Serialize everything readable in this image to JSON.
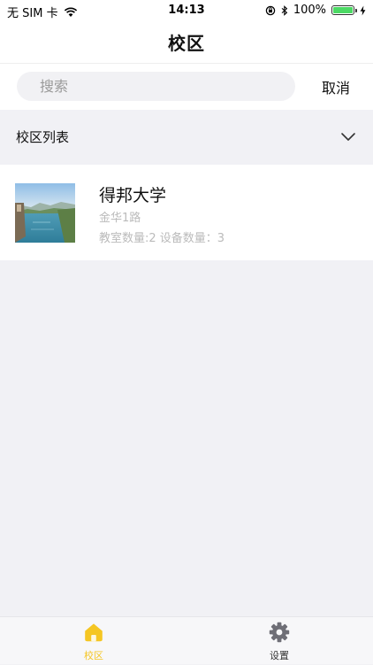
{
  "status_bar": {
    "carrier": "无 SIM 卡",
    "time": "14:13",
    "battery": "100%",
    "icons": [
      "wifi-icon",
      "orientation-lock-icon",
      "bluetooth-icon",
      "battery-icon",
      "charging-icon"
    ]
  },
  "header": {
    "title": "校区"
  },
  "search": {
    "placeholder": "搜索",
    "value": "",
    "cancel_label": "取消"
  },
  "section": {
    "title": "校区列表",
    "icon": "chevron-down-icon"
  },
  "campuses": [
    {
      "name": "得邦大学",
      "address": "金华1路",
      "stats": "教室数量:2 设备数量：3",
      "thumbnail": "river-landscape"
    }
  ],
  "tabs": [
    {
      "label": "校区",
      "icon": "home-icon",
      "active": true
    },
    {
      "label": "设置",
      "icon": "gear-icon",
      "active": false
    }
  ],
  "colors": {
    "accent": "#f5c623",
    "inactive_icon": "#6e6e76",
    "page_bg": "#f1f1f5"
  }
}
